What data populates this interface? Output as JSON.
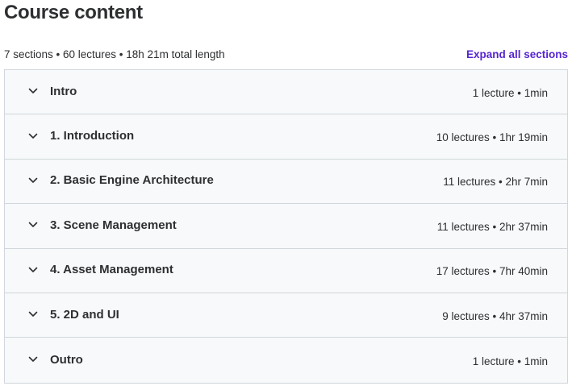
{
  "header": {
    "title": "Course content",
    "summary": "7 sections • 60 lectures • 18h 21m total length",
    "expand_all_label": "Expand all sections"
  },
  "sections": [
    {
      "title": "Intro",
      "meta": "1 lecture • 1min"
    },
    {
      "title": "1. Introduction",
      "meta": "10 lectures • 1hr 19min"
    },
    {
      "title": "2. Basic Engine Architecture",
      "meta": "11 lectures • 2hr 7min"
    },
    {
      "title": "3. Scene Management",
      "meta": "11 lectures • 2hr 37min"
    },
    {
      "title": "4. Asset Management",
      "meta": "17 lectures • 7hr 40min"
    },
    {
      "title": "5. 2D and UI",
      "meta": "9 lectures • 4hr 37min"
    },
    {
      "title": "Outro",
      "meta": "1 lecture • 1min"
    }
  ],
  "icons": {
    "section_toggle": "chevron-down-icon"
  },
  "colors": {
    "accent": "#5624d0",
    "text": "#2d2f31",
    "section_bg": "#f7f9fa",
    "border": "#d1d7dc"
  }
}
